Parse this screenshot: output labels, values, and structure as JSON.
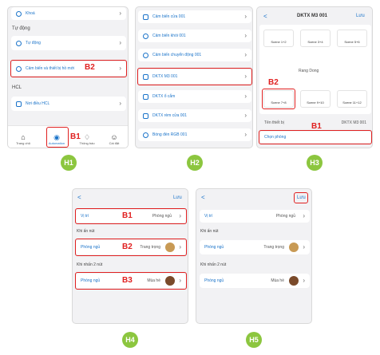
{
  "h1": {
    "top_item": "Khoá",
    "section_auto": "Tự động",
    "item_auto": "Tự động",
    "item_sensor": "Cảm biến và thiết bị hồ mới",
    "section_hcl": "HCL",
    "item_hcl": "Nơi điều HCL",
    "tabs": [
      "Trang chủ",
      "Automation",
      "Thông báo",
      "Cài đặt"
    ],
    "marker_b1": "B1",
    "marker_b2": "B2",
    "badge": "H1"
  },
  "h2": {
    "items": [
      "Cảm biến cửa 001",
      "Cảm biến khói 001",
      "Cảm biến chuyển động 001",
      "DKTX M3 001",
      "DKTX ổ cắm",
      "DKTX rèm cửa 001",
      "Bóng đèn RGB 001"
    ],
    "badge": "H2"
  },
  "h3": {
    "back": "<",
    "title": "DKTX M3 001",
    "save": "Lưu",
    "scenes": [
      "Scene 1+2",
      "Scene 3+4",
      "Scene 5+6",
      "Scene 7+8",
      "Scene 9+10",
      "Scene 11+12"
    ],
    "center_brand": "Rang Dong",
    "device_label": "Tên thiết bị",
    "device_value": "DKTX M3 001",
    "choose_room": "Chọn phòng",
    "marker_b1": "B1",
    "marker_b2": "B2",
    "badge": "H3"
  },
  "h4": {
    "back": "<",
    "save": "Lưu",
    "position_label": "Vị trí",
    "position_value": "Phòng ngủ",
    "section_one": "Khi ấn nút",
    "one_room": "Phòng ngủ",
    "one_scene": "Trang trọng",
    "section_two": "Khi nhấn 2 nút",
    "two_room": "Phòng ngủ",
    "two_scene": "Mùa hè",
    "marker_b1": "B1",
    "marker_b2": "B2",
    "marker_b3": "B3",
    "badge": "H4"
  },
  "h5": {
    "back": "<",
    "save": "Lưu",
    "position_label": "Vị trí",
    "position_value": "Phòng ngủ",
    "section_one": "Khi ấn nút",
    "one_room": "Phòng ngủ",
    "one_scene": "Trang trọng",
    "section_two": "Khi nhấn 2 nút",
    "two_room": "Phòng ngủ",
    "two_scene": "Mùa hè",
    "badge": "H5"
  }
}
